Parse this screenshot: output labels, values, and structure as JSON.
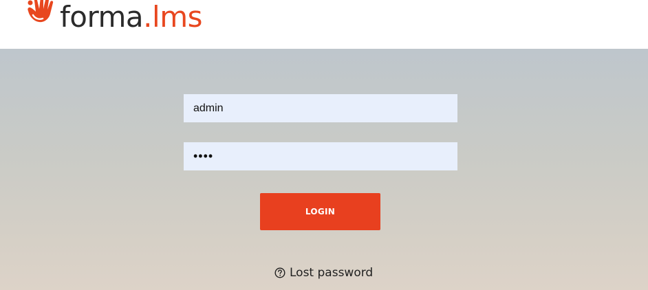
{
  "brand": {
    "logo_word_1": "forma",
    "logo_dot": ".",
    "logo_word_2": "lms",
    "accent_color": "#e8471f"
  },
  "login_form": {
    "username_value": "admin",
    "password_value": "••••",
    "submit_label": "LOGIN",
    "lost_password_label": "Lost password",
    "lost_password_icon": "question-circle-icon"
  }
}
